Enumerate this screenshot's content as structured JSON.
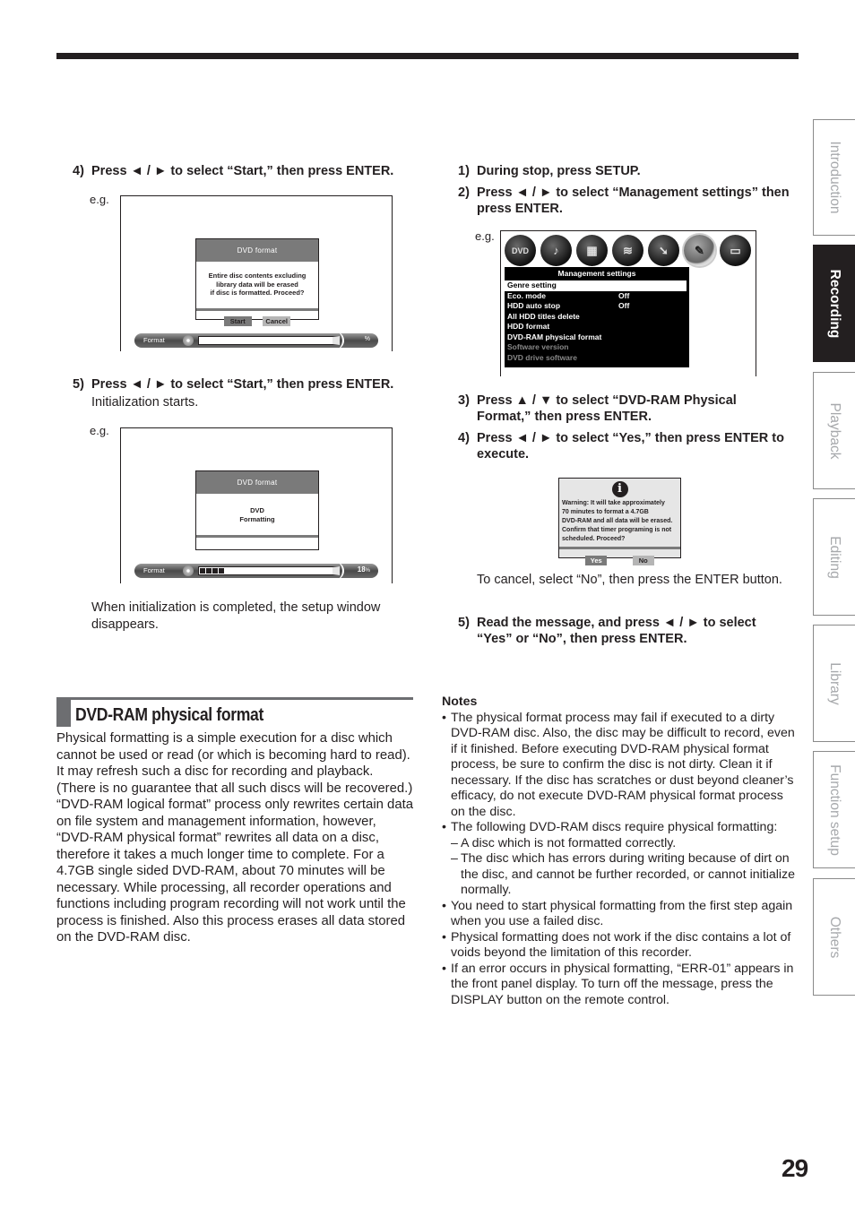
{
  "page_number": "29",
  "side_tabs": [
    {
      "label": "Introduction",
      "active": false
    },
    {
      "label": "Recording",
      "active": true
    },
    {
      "label": "Playback",
      "active": false
    },
    {
      "label": "Editing",
      "active": false
    },
    {
      "label": "Library",
      "active": false
    },
    {
      "label": "Function setup",
      "active": false
    },
    {
      "label": "Others",
      "active": false
    }
  ],
  "left_steps": {
    "step4": {
      "num": "4)",
      "text": "Press ◄ / ► to select “Start,” then press ENTER."
    },
    "step5": {
      "num": "5)",
      "text": "Press ◄ / ► to select “Start,” then press ENTER.",
      "sub": "Initialization starts."
    },
    "eg_label": "e.g.",
    "after_text": "When initialization is completed, the setup window disappears."
  },
  "screen1": {
    "dialog_title": "DVD format",
    "message_lines": [
      "Entire disc contents excluding",
      "library data will be erased",
      "if disc is formatted. Proceed?"
    ],
    "buttons": [
      "Start",
      "Cancel"
    ],
    "bar_label": "Format",
    "bar_percent_text": "%",
    "progress": 0
  },
  "screen2": {
    "dialog_title": "DVD format",
    "message_lines": [
      "DVD",
      "Formatting"
    ],
    "bar_label": "Format",
    "bar_percent_text": "18",
    "bar_percent_unit": "%",
    "progress": 0.18
  },
  "right_steps": {
    "step1": {
      "num": "1)",
      "text": "During stop, press SETUP."
    },
    "step2": {
      "num": "2)",
      "text": "Press ◄ / ► to select “Management settings” then press ENTER."
    },
    "step3": {
      "num": "3)",
      "text": "Press ▲ / ▼ to select “DVD-RAM Physical Format,” then press ENTER."
    },
    "step4": {
      "num": "4)",
      "text": "Press  ◄ / ►  to select “Yes,” then press ENTER to execute."
    },
    "cancel_note": "To cancel, select “No”, then press the ENTER button.",
    "step5": {
      "num": "5)",
      "text": "Read the message, and press ◄ / ► to select “Yes” or “No”, then press ENTER."
    },
    "eg_label": "e.g."
  },
  "mgmt_screen": {
    "icons": [
      {
        "name": "dvd-video-icon",
        "glyph": "DVD",
        "selected": false
      },
      {
        "name": "speaker-icon",
        "glyph": "♪",
        "selected": false
      },
      {
        "name": "window-icon",
        "glyph": "▦",
        "selected": false
      },
      {
        "name": "equalizer-icon",
        "glyph": "≋",
        "selected": false
      },
      {
        "name": "disc-arrow-icon",
        "glyph": "➘",
        "selected": false
      },
      {
        "name": "wrench-icon",
        "glyph": "✎",
        "selected": true
      },
      {
        "name": "recorder-icon",
        "glyph": "▭",
        "selected": false
      }
    ],
    "title": "Management settings",
    "items": [
      {
        "label": "Genre setting",
        "value": "",
        "state": "highlighted"
      },
      {
        "label": "Eco. mode",
        "value": "Off",
        "state": "normal"
      },
      {
        "label": "HDD auto stop",
        "value": "Off",
        "state": "normal"
      },
      {
        "label": "All HDD titles delete",
        "value": "",
        "state": "normal"
      },
      {
        "label": "HDD format",
        "value": "",
        "state": "normal"
      },
      {
        "label": "DVD-RAM physical format",
        "value": "",
        "state": "normal"
      },
      {
        "label": "Software version",
        "value": "",
        "state": "dimmed"
      },
      {
        "label": "DVD drive software",
        "value": "",
        "state": "dimmed"
      }
    ]
  },
  "warning_dialog": {
    "icon": "i",
    "lines": [
      "Warning: It will take approximately",
      "70 minutes to format a 4.7GB",
      "DVD-RAM and all data will be erased.",
      "Confirm that timer programing is not",
      "scheduled. Proceed?"
    ],
    "buttons": [
      "Yes",
      "No"
    ]
  },
  "section": {
    "title": "DVD-RAM physical format",
    "paragraphs": [
      "Physical formatting is a simple execution for a disc which cannot be used or read (or which is becoming hard to read). It may refresh such a disc for recording and playback. (There is no guarantee that all such discs will be recovered.)",
      "“DVD-RAM logical format” process only rewrites certain data on file system and management information, however, “DVD-RAM physical format” rewrites all data on a disc, therefore it takes a much longer time to complete. For a 4.7GB single sided DVD-RAM, about 70 minutes will be necessary. While processing, all recorder operations and functions including program recording will not work until the process is finished. Also this process erases all data stored on the DVD-RAM disc."
    ]
  },
  "notes": {
    "heading": "Notes",
    "items": [
      {
        "type": "bullet",
        "text": "The physical format process may fail if executed to a dirty DVD-RAM disc. Also, the disc may be difficult to record, even if it finished. Before executing DVD-RAM physical format process, be sure to confirm the disc is not dirty. Clean it if necessary. If the disc has scratches or dust beyond cleaner’s efficacy, do not execute DVD-RAM physical format process on the disc."
      },
      {
        "type": "bullet",
        "text": "The following DVD-RAM discs require physical formatting:"
      },
      {
        "type": "dash",
        "text": "A disc which is not formatted correctly."
      },
      {
        "type": "dash",
        "text": "The disc which has errors during writing because of dirt on the disc, and cannot be further recorded, or cannot initialize normally."
      },
      {
        "type": "bullet",
        "text": "You need to start physical formatting from the first step again when you use a failed disc."
      },
      {
        "type": "bullet",
        "text": "Physical formatting does not work if the disc contains a lot of voids beyond the limitation of this recorder."
      },
      {
        "type": "bullet",
        "text": "If an error occurs in physical formatting, “ERR-01” appears in the front panel display. To turn off the message, press the DISPLAY button on the remote control."
      }
    ]
  }
}
